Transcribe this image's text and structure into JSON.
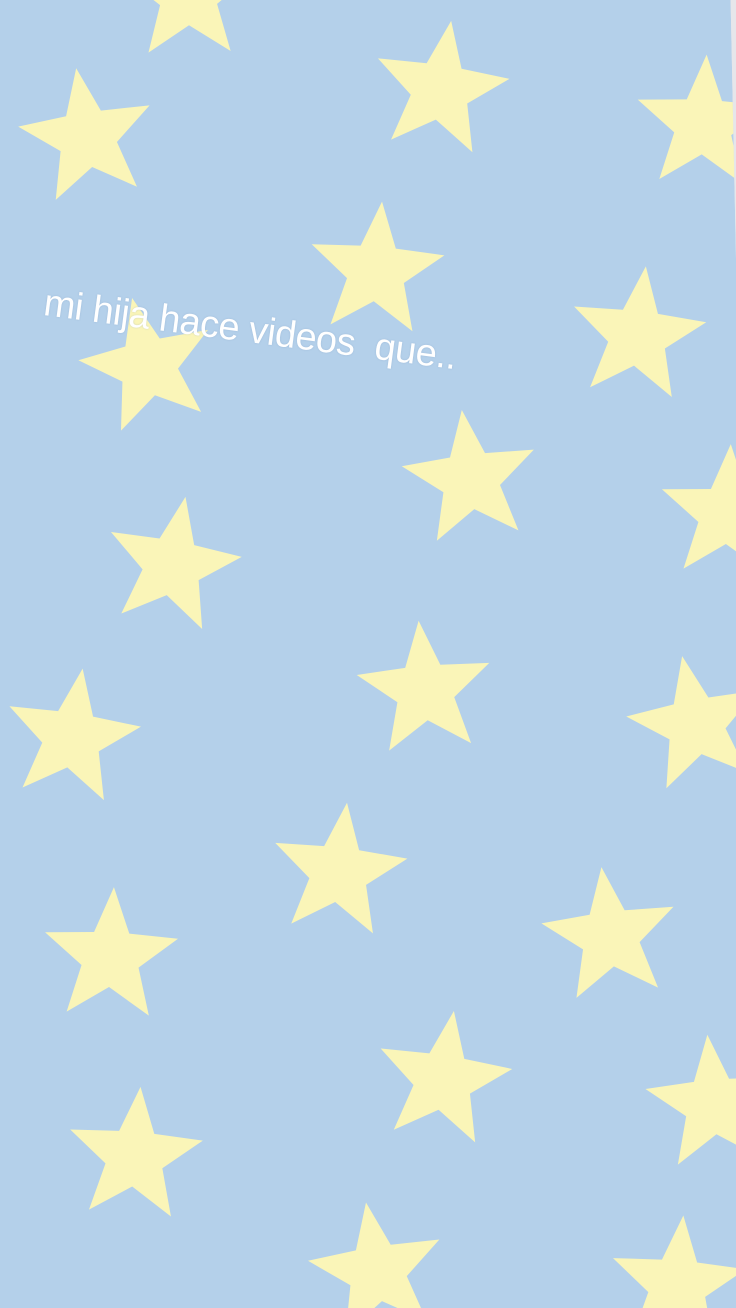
{
  "caption": {
    "text": "mi hija hace videos  que.."
  },
  "colors": {
    "background": "#b4d0ea",
    "star": "#faf5b8",
    "edge": "#e6e6ea",
    "caption_text": "#ffffff"
  },
  "pattern": {
    "motif": "star-icon",
    "description_free": true
  }
}
